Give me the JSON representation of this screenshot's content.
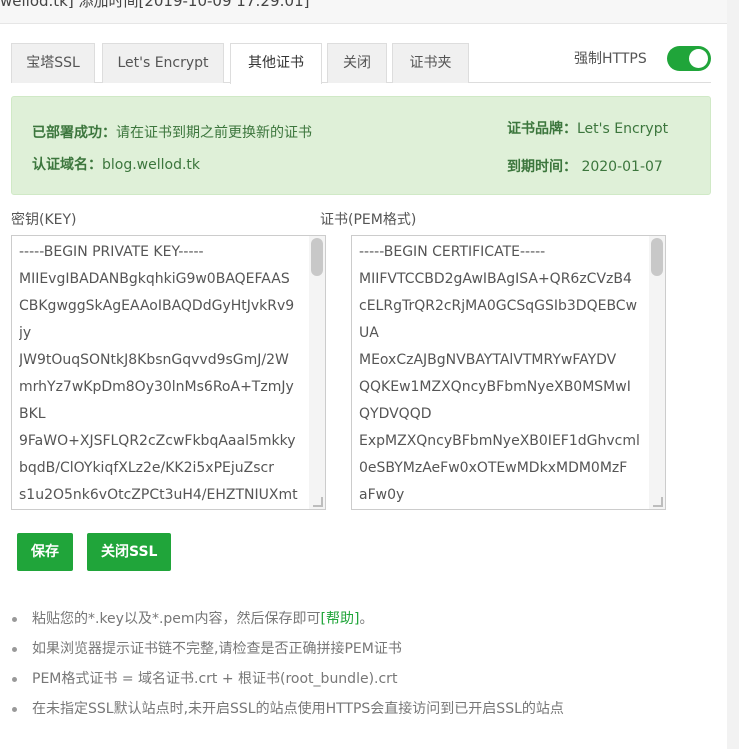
{
  "header": {
    "clipped_text": "wellod.tk]    添加时间[2019-10-09 17:29:01]"
  },
  "tabs": [
    {
      "label": "宝塔SSL"
    },
    {
      "label": "Let's Encrypt"
    },
    {
      "label": "其他证书"
    },
    {
      "label": "关闭"
    },
    {
      "label": "证书夹"
    }
  ],
  "force_https": {
    "label": "强制HTTPS",
    "enabled": true
  },
  "status": {
    "deployed_label": "已部署成功：",
    "deployed_text": "请在证书到期之前更换新的证书",
    "domain_label": "认证域名：",
    "domain_value": "blog.wellod.tk",
    "brand_label": "证书品牌：",
    "brand_value": "Let's Encrypt",
    "expiry_label": "到期时间：",
    "expiry_value": "2020-01-07"
  },
  "key": {
    "label": "密钥(KEY)",
    "lines": [
      "-----BEGIN PRIVATE KEY-----",
      "MIIEvgIBADANBgkqhkiG9w0BAQEFAAS",
      "CBKgwggSkAgEAAoIBAQDdGyHtJvkRv9",
      "jy",
      "JW9tOuqSONtkJ8KbsnGqvvd9sGmJ/2W",
      "mrhYz7wKpDm8Oy30lnMs6RoA+TzmJy",
      "BKL",
      "9FaWO+XJSFLQR2cZcwFkbqAaal5mkky",
      "bqdB/ClOYkiqfXLz2e/KK2i5xPEjuZscr",
      "s1u2O5nk6vOtcZPCt3uH4/EHZTNIUXmt"
    ]
  },
  "cert": {
    "label": "证书(PEM格式)",
    "lines": [
      "-----BEGIN CERTIFICATE-----",
      "MIIFVTCCBD2gAwIBAgISA+QR6zCVzB4",
      "cELRgTrQR2cRjMA0GCSqGSIb3DQEBCw",
      "UA",
      "MEoxCzAJBgNVBAYTAlVTMRYwFAYDV",
      "QQKEw1MZXQncyBFbmNyeXB0MSMwI",
      "QYDVQQD",
      "ExpMZXQncyBFbmNyeXB0IEF1dGhvcml",
      "0eSBYMzAeFw0xOTEwMDkxMDM0MzF",
      "aFw0y"
    ]
  },
  "buttons": {
    "save": "保存",
    "close_ssl": "关闭SSL"
  },
  "tips": {
    "t1_pre": "粘贴您的*.key以及*.pem内容，然后保存即可",
    "t1_link": "[帮助]",
    "t1_post": "。",
    "t2": "如果浏览器提示证书链不完整,请检查是否正确拼接PEM证书",
    "t3": "PEM格式证书 = 域名证书.crt + 根证书(root_bundle).crt",
    "t4": "在未指定SSL默认站点时,未开启SSL的站点使用HTTPS会直接访问到已开启SSL的站点"
  },
  "colors": {
    "accent": "#20a53a",
    "success_bg": "#dff0d8",
    "success_text": "#3c763d"
  }
}
